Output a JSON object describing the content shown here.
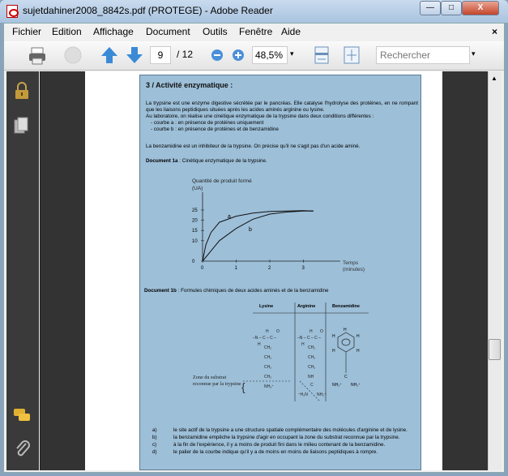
{
  "window": {
    "title": "sujetdahiner2008_8842s.pdf (PROTEGE) - Adobe Reader",
    "minimize": "—",
    "maximize": "□",
    "close": "X"
  },
  "menu": [
    "Fichier",
    "Edition",
    "Affichage",
    "Document",
    "Outils",
    "Fenêtre",
    "Aide"
  ],
  "menu_close": "×",
  "toolbar": {
    "page_current": "9",
    "page_total": "/ 12",
    "zoom": "48,5%",
    "search_placeholder": "Rechercher"
  },
  "document": {
    "heading": "3 / Activité enzymatique :",
    "intro1": "La trypsine est une enzyme digestive sécrétée par le pancréas. Elle catalyse l'hydrolyse des protéines, en ne rompant que les liaisons peptidiques situées après les acides aminés arginine ou lysine.",
    "intro2": "Au laboratoire, on réalise une cinétique enzymatique de la trypsine dans deux conditions différentes :",
    "bullet_a": "- courbe a : en présence de protéines uniquement",
    "bullet_b": "- courbe b : en présence de protéines et de benzamidine",
    "inhibitor": "La benzamidine est un inhibiteur de la trypsine. On précise qu'il ne s'agit pas d'un acide aminé.",
    "doc1a_label": "Document 1a",
    "doc1a_text": " : Cinétique enzymatique de la trypsine.",
    "graph": {
      "ylabel1": "Quantité de produit formé",
      "ylabel2": "(UA)",
      "xlabel1": "Temps",
      "xlabel2": "(minutes)",
      "yticks": [
        "0",
        "10",
        "15",
        "20",
        "25"
      ],
      "xticks": [
        "0",
        "1",
        "2",
        "3"
      ],
      "curve_a_label": "a",
      "curve_b_label": "b",
      "curve_a": [
        [
          0,
          0
        ],
        [
          0.1,
          8
        ],
        [
          0.25,
          14
        ],
        [
          0.5,
          19
        ],
        [
          1,
          22
        ],
        [
          1.5,
          23.5
        ],
        [
          2,
          24.3
        ],
        [
          3,
          24.7
        ],
        [
          3.3,
          24.5
        ]
      ],
      "curve_b": [
        [
          0,
          0
        ],
        [
          0.25,
          5
        ],
        [
          0.5,
          10
        ],
        [
          1,
          16
        ],
        [
          1.5,
          20.5
        ],
        [
          2,
          23
        ],
        [
          2.5,
          24
        ],
        [
          3,
          24.5
        ],
        [
          3.3,
          24.5
        ]
      ]
    },
    "doc1b_label": "Document 1b",
    "doc1b_text": " : Formules chimiques de deux acides aminés et de la benzamidine",
    "table_headers": [
      "Lysine",
      "Arginine",
      "Benzamidine"
    ],
    "zone_label": "Zone du substrat reconnue par la trypsine",
    "answers": [
      {
        "letter": "a)",
        "text": "le site actif de la trypsine a une structure spatiale complémentaire des molécules d'arginine et de lysine."
      },
      {
        "letter": "b)",
        "text": "la benzamidine empêche la trypsine d'agir en occupant la zone du substrat reconnue par la trypsine."
      },
      {
        "letter": "c)",
        "text": "à la fin de l'expérience, il y a moins de produit fini dans le milieu contenant de la benzamidine."
      },
      {
        "letter": "d)",
        "text": "le palier de la courbe indique qu'il y a de moins en moins de liaisons peptidiques à rompre."
      }
    ]
  }
}
